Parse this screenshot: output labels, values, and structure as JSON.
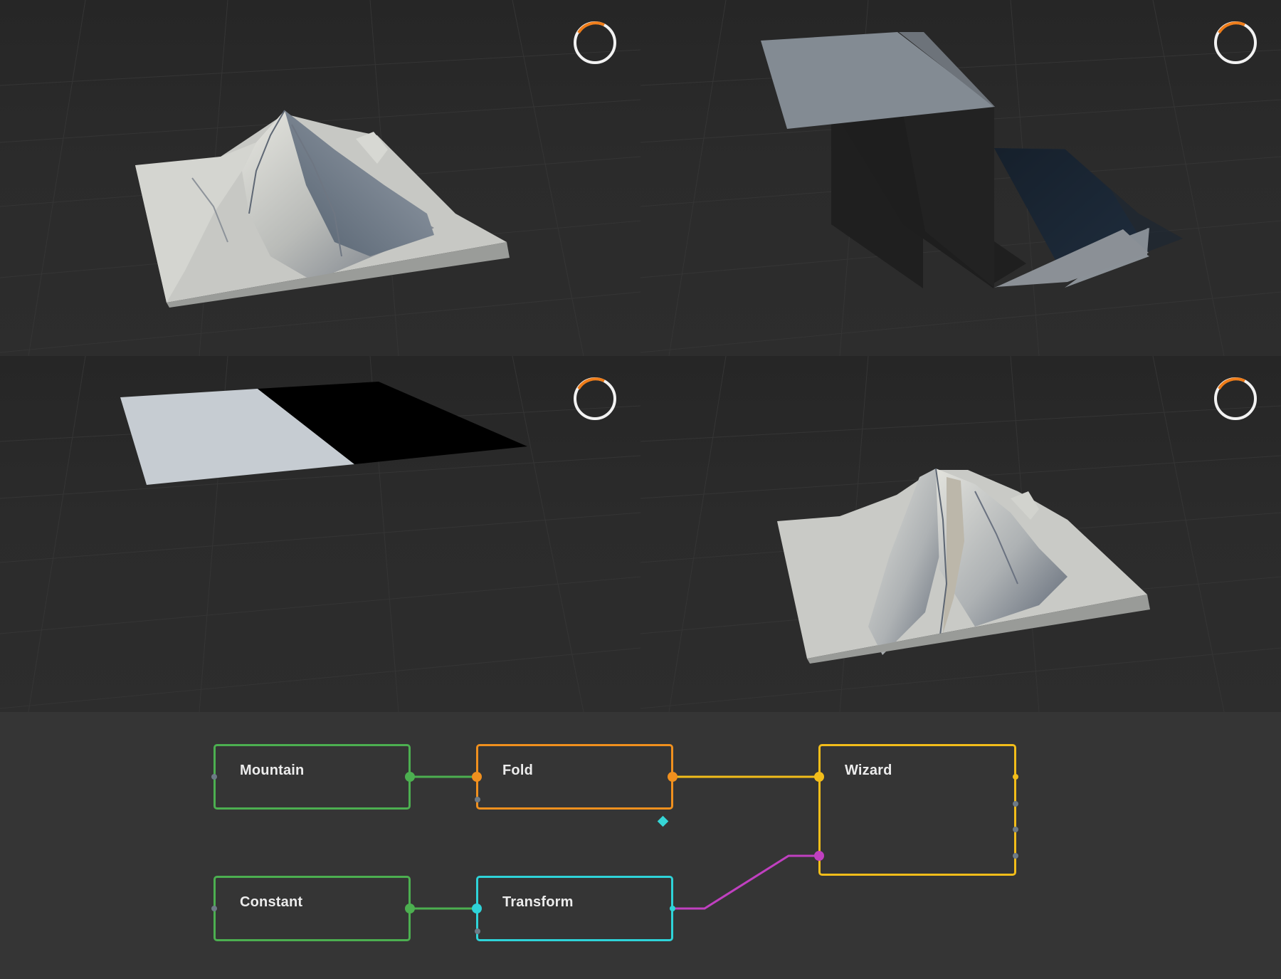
{
  "viewports": [
    {
      "id": "mountain",
      "label": "mountain-preview"
    },
    {
      "id": "fold",
      "label": "fold-preview"
    },
    {
      "id": "constant",
      "label": "constant-preview"
    },
    {
      "id": "wizard",
      "label": "wizard-preview"
    }
  ],
  "spinner_colors": {
    "track": "#f2f2f2",
    "accent": "#ef7d1a"
  },
  "graph": {
    "nodes": {
      "mountain": {
        "title": "Mountain",
        "color": "#4caf50"
      },
      "fold": {
        "title": "Fold",
        "color": "#f0901e"
      },
      "wizard": {
        "title": "Wizard",
        "color": "#f2bd1a"
      },
      "constant": {
        "title": "Constant",
        "color": "#4caf50"
      },
      "transform": {
        "title": "Transform",
        "color": "#2ed3d8"
      }
    },
    "wire_colors": {
      "mountain_fold": "#4caf50",
      "fold_wizard": "#f2bd1a",
      "constant_transform": "#4caf50",
      "transform_wizard": "#c040c0"
    },
    "port_colors": {
      "inactive": "#6d7a86",
      "marker": "#36d6d6"
    }
  }
}
